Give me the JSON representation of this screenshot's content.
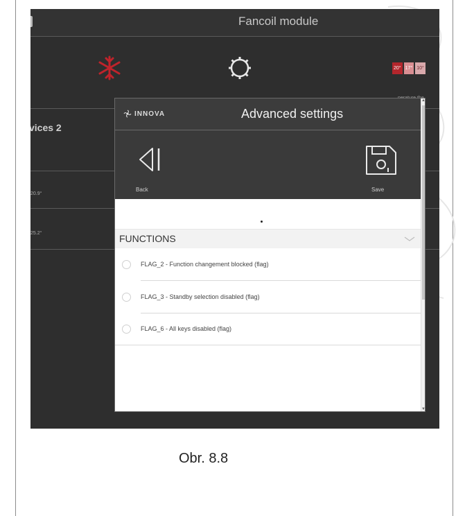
{
  "app": {
    "title": "Fancoil module",
    "devices_label": "vices 2",
    "values": [
      "20.9°",
      "25.2°"
    ],
    "temp_badges": [
      "20°",
      "17°",
      "10°"
    ],
    "temp_caption": "perature the",
    "icons": {
      "mode_cooling": "snowflake-icon",
      "mode_auto": "gear-icon"
    }
  },
  "dialog": {
    "brand": "INNOVA",
    "title": "Advanced settings",
    "back_label": "Back",
    "save_label": "Save",
    "section_title": "FUNCTIONS",
    "items": [
      {
        "label": "FLAG_2 - Function changement blocked (flag)"
      },
      {
        "label": "FLAG_3 - Standby selection disabled (flag)"
      },
      {
        "label": "FLAG_6 - All keys disabled (flag)"
      }
    ]
  },
  "caption": "Obr. 8.8",
  "colors": {
    "accent_red": "#b3262c",
    "panel_dark": "#3a3a3a",
    "background_dark": "#2e2e2e"
  }
}
